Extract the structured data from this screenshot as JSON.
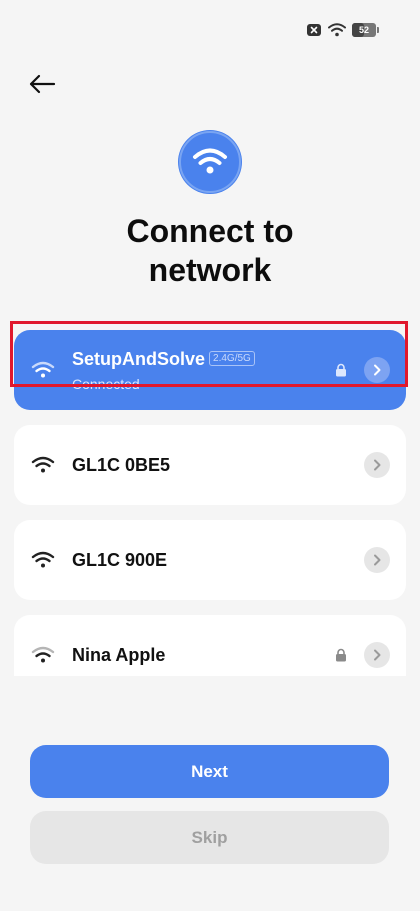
{
  "status_bar": {
    "battery_level": "52",
    "icons": [
      "notification-x-icon",
      "wifi-signal-icon",
      "battery-icon"
    ]
  },
  "header": {
    "back_icon": "arrow-left-icon",
    "hero_icon": "wifi-icon",
    "title": "Connect to\nnetwork"
  },
  "networks": [
    {
      "name": "SetupAndSolve",
      "band": "2.4G/5G",
      "status": "Connected",
      "secured": true,
      "selected": true
    },
    {
      "name": "GL1C 0BE5",
      "band": "",
      "status": "",
      "secured": false,
      "selected": false
    },
    {
      "name": "GL1C 900E",
      "band": "",
      "status": "",
      "secured": false,
      "selected": false
    },
    {
      "name": "Nina Apple",
      "band": "",
      "status": "",
      "secured": true,
      "selected": false
    }
  ],
  "actions": {
    "next_label": "Next",
    "skip_label": "Skip"
  },
  "colors": {
    "accent": "#4a82ed",
    "background": "#f5f5f5",
    "highlight_outline": "#e0182d",
    "disabled_button": "#e6e6e6"
  }
}
